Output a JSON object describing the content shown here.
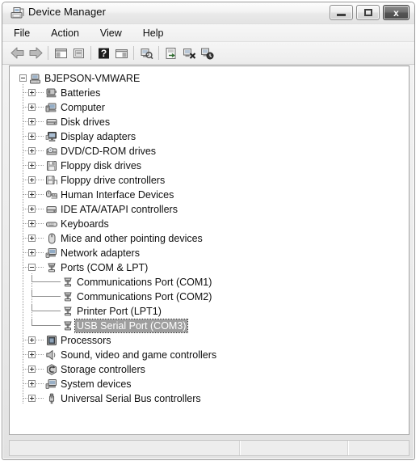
{
  "window": {
    "title": "Device Manager",
    "icon": "device-manager-icon",
    "controls": {
      "minimize": "minimize-button",
      "maximize": "maximize-button",
      "close_label": "x"
    }
  },
  "menubar": {
    "items": [
      {
        "label": "File",
        "name": "menu-file"
      },
      {
        "label": "Action",
        "name": "menu-action"
      },
      {
        "label": "View",
        "name": "menu-view"
      },
      {
        "label": "Help",
        "name": "menu-help"
      }
    ]
  },
  "toolbar": {
    "buttons": [
      {
        "name": "back-icon",
        "type": "arrow-left"
      },
      {
        "name": "forward-icon",
        "type": "arrow-right"
      },
      {
        "name": "separator",
        "type": "sep"
      },
      {
        "name": "show-hide-console-tree-icon",
        "type": "panel-left"
      },
      {
        "name": "properties-icon",
        "type": "properties"
      },
      {
        "name": "separator",
        "type": "sep"
      },
      {
        "name": "help-icon",
        "type": "help"
      },
      {
        "name": "show-hide-action-pane-icon",
        "type": "panel-right"
      },
      {
        "name": "separator",
        "type": "sep"
      },
      {
        "name": "scan-for-hardware-changes-icon",
        "type": "scan"
      },
      {
        "name": "separator",
        "type": "sep"
      },
      {
        "name": "update-driver-software-icon",
        "type": "update-driver"
      },
      {
        "name": "uninstall-device-icon",
        "type": "uninstall"
      },
      {
        "name": "disable-device-icon",
        "type": "disable"
      }
    ]
  },
  "tree": {
    "nodes": [
      {
        "label": "BJEPSON-VMWARE",
        "level": 0,
        "state": "expanded",
        "icon": "computer-root-icon",
        "selected": false
      },
      {
        "label": "Batteries",
        "level": 1,
        "state": "collapsed",
        "icon": "battery-icon",
        "selected": false
      },
      {
        "label": "Computer",
        "level": 1,
        "state": "collapsed",
        "icon": "computer-icon",
        "selected": false
      },
      {
        "label": "Disk drives",
        "level": 1,
        "state": "collapsed",
        "icon": "disk-drive-icon",
        "selected": false
      },
      {
        "label": "Display adapters",
        "level": 1,
        "state": "collapsed",
        "icon": "display-adapter-icon",
        "selected": false
      },
      {
        "label": "DVD/CD-ROM drives",
        "level": 1,
        "state": "collapsed",
        "icon": "dvd-drive-icon",
        "selected": false
      },
      {
        "label": "Floppy disk drives",
        "level": 1,
        "state": "collapsed",
        "icon": "floppy-disk-icon",
        "selected": false
      },
      {
        "label": "Floppy drive controllers",
        "level": 1,
        "state": "collapsed",
        "icon": "floppy-controller-icon",
        "selected": false
      },
      {
        "label": "Human Interface Devices",
        "level": 1,
        "state": "collapsed",
        "icon": "hid-icon",
        "selected": false
      },
      {
        "label": "IDE ATA/ATAPI controllers",
        "level": 1,
        "state": "collapsed",
        "icon": "ide-controller-icon",
        "selected": false
      },
      {
        "label": "Keyboards",
        "level": 1,
        "state": "collapsed",
        "icon": "keyboard-icon",
        "selected": false
      },
      {
        "label": "Mice and other pointing devices",
        "level": 1,
        "state": "collapsed",
        "icon": "mouse-icon",
        "selected": false
      },
      {
        "label": "Network adapters",
        "level": 1,
        "state": "collapsed",
        "icon": "network-adapter-icon",
        "selected": false
      },
      {
        "label": "Ports (COM & LPT)",
        "level": 1,
        "state": "expanded",
        "icon": "port-icon",
        "selected": false
      },
      {
        "label": "Communications Port (COM1)",
        "level": 2,
        "state": "leaf",
        "icon": "port-icon",
        "selected": false
      },
      {
        "label": "Communications Port (COM2)",
        "level": 2,
        "state": "leaf",
        "icon": "port-icon",
        "selected": false
      },
      {
        "label": "Printer Port (LPT1)",
        "level": 2,
        "state": "leaf",
        "icon": "port-icon",
        "selected": false
      },
      {
        "label": "USB Serial Port (COM3)",
        "level": 2,
        "state": "leaf",
        "icon": "port-icon",
        "selected": true
      },
      {
        "label": "Processors",
        "level": 1,
        "state": "collapsed",
        "icon": "processor-icon",
        "selected": false
      },
      {
        "label": "Sound, video and game controllers",
        "level": 1,
        "state": "collapsed",
        "icon": "sound-icon",
        "selected": false
      },
      {
        "label": "Storage controllers",
        "level": 1,
        "state": "collapsed",
        "icon": "storage-controller-icon",
        "selected": false
      },
      {
        "label": "System devices",
        "level": 1,
        "state": "collapsed",
        "icon": "system-device-icon",
        "selected": false
      },
      {
        "label": "Universal Serial Bus controllers",
        "level": 1,
        "state": "collapsed",
        "icon": "usb-controller-icon",
        "selected": false
      }
    ]
  },
  "statusbar": {
    "panes": [
      "",
      "",
      ""
    ]
  },
  "colors": {
    "selection_bg": "#9e9e9e",
    "selection_fg": "#ffffff",
    "window_bg": "#ebebeb",
    "panel_bg": "#ffffff"
  }
}
